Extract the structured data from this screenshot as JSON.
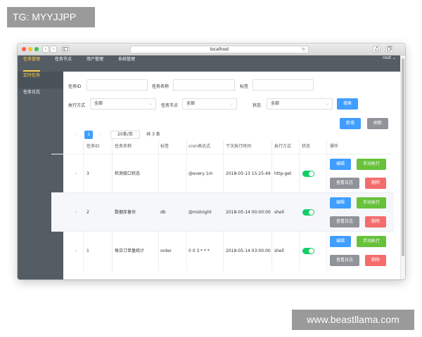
{
  "watermark_top": "TG: MYYJJPP",
  "watermark_bottom": "www.beastllama.com",
  "browser": {
    "url": "localhost",
    "reload": "↻",
    "back": "‹",
    "forward": "›"
  },
  "topnav": {
    "items": [
      "任务管理",
      "任务节点",
      "用户管理",
      "系统管理"
    ],
    "active_index": 0,
    "user": "root ⌄"
  },
  "sidebar": {
    "items": [
      "定时任务",
      "任务日志"
    ],
    "active_index": 0
  },
  "filters": {
    "task_id_label": "任务ID",
    "task_name_label": "任务名称",
    "tag_label": "标签",
    "exec_mode_label": "执行方式",
    "exec_mode_value": "全部",
    "node_label": "任务节点",
    "node_value": "全部",
    "status_label": "状态",
    "status_value": "全部",
    "search_button": "搜索"
  },
  "actions": {
    "add_button": "新增",
    "refresh_button": "刷新"
  },
  "pager": {
    "prev": "‹",
    "current_page": "1",
    "next": "›",
    "page_size": "20条/页",
    "total": "共 3 条"
  },
  "table": {
    "headers": [
      "任务ID",
      "任务名称",
      "标签",
      "cron表达式",
      "下次执行时间",
      "执行方式",
      "状态",
      "操作"
    ],
    "expand_icon": "›",
    "rows": [
      {
        "id": "3",
        "name": "检测接口状态",
        "tag": "",
        "cron": "@every 1m",
        "next": "2018-05-13 15:25:49",
        "mode": "http-get",
        "status": true
      },
      {
        "id": "2",
        "name": "数据库备份",
        "tag": "db",
        "cron": "@midnight",
        "next": "2018-05-14 00:00:00",
        "mode": "shell",
        "status": true
      },
      {
        "id": "1",
        "name": "每日订单量统计",
        "tag": "order",
        "cron": "0 0 3 * * *",
        "next": "2018-05-14 03:00:00",
        "mode": "shell",
        "status": true
      }
    ],
    "row_actions": {
      "edit": "编辑",
      "run": "手动执行",
      "log": "查看日志",
      "delete": "删除"
    }
  },
  "colors": {
    "nav_bg": "#545c64",
    "nav_active": "#ffd04b",
    "primary": "#409eff",
    "success": "#67c23a",
    "danger": "#f56c6c",
    "info": "#909399",
    "switch_on": "#13ce66"
  }
}
